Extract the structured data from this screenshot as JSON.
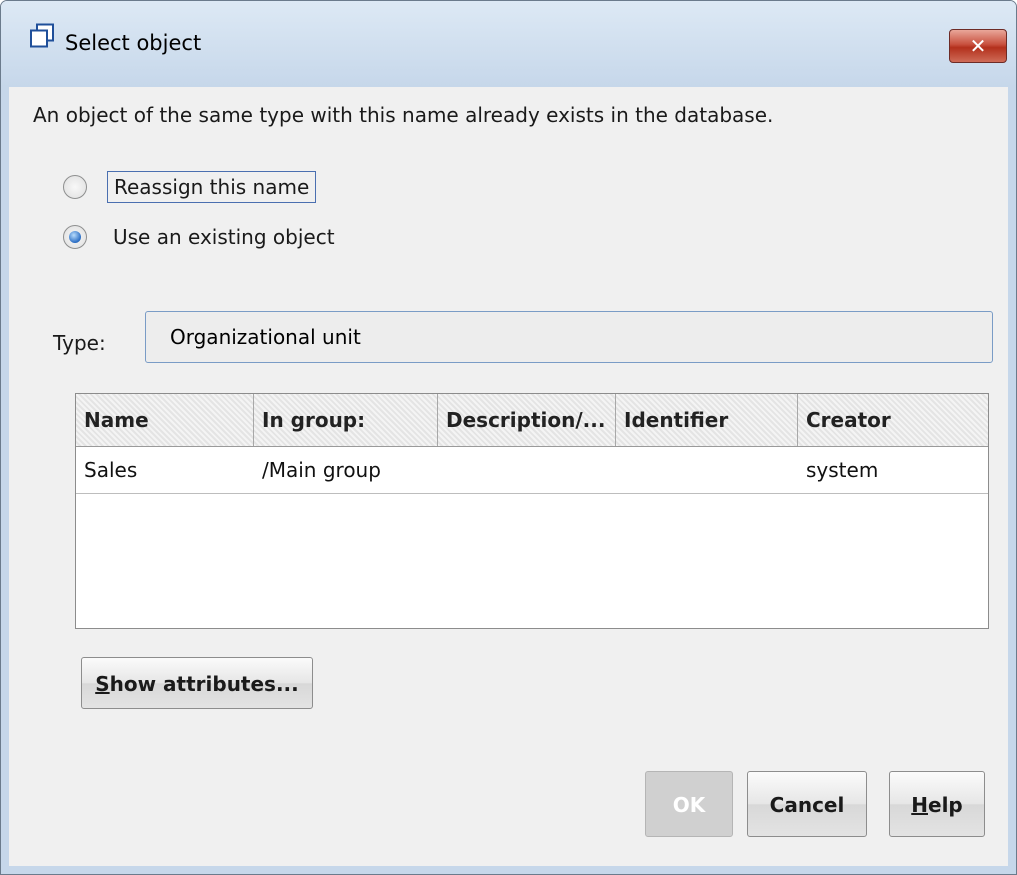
{
  "window": {
    "title": "Select object",
    "icon": "window-copy-icon",
    "close_glyph": "✕"
  },
  "message": "An object of the same type with this name already exists in the database.",
  "options": {
    "reassign": {
      "label": "Reassign this name",
      "checked": false
    },
    "use_existing": {
      "label": "Use an existing object",
      "checked": true
    }
  },
  "type_field": {
    "label": "Type:",
    "value": "Organizational unit"
  },
  "table": {
    "columns": [
      "Name",
      "In group:",
      "Description/...",
      "Identifier",
      "Creator"
    ],
    "rows": [
      [
        "Sales",
        "/Main group",
        "",
        "",
        "system"
      ]
    ]
  },
  "buttons": {
    "show_attributes": "Show attributes...",
    "ok": "OK",
    "cancel": "Cancel",
    "help": "Help"
  }
}
